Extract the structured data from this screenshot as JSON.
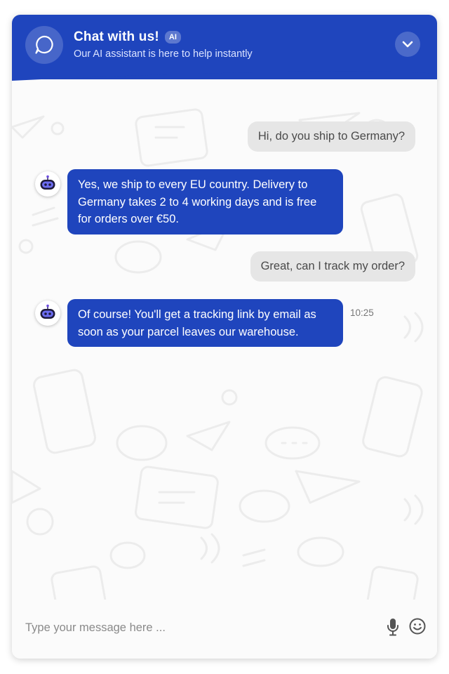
{
  "header": {
    "title": "Chat with us!",
    "badge": "AI",
    "subtitle": "Our AI assistant is here to help instantly",
    "avatar_icon": "chat-bubble-icon",
    "collapse_icon": "chevron-down-icon"
  },
  "messages": [
    {
      "sender": "user",
      "text": "Hi, do you ship to Germany?"
    },
    {
      "sender": "bot",
      "text": "Yes, we ship to every EU country. Delivery to Germany takes 2 to 4 working days and is free for orders over €50."
    },
    {
      "sender": "user",
      "text": "Great, can I track my order?"
    },
    {
      "sender": "bot",
      "text": "Of course! You'll get a tracking link by email as soon as your parcel leaves our warehouse.",
      "time": "10:25"
    }
  ],
  "composer": {
    "placeholder": "Type your message here ...",
    "mic_icon": "microphone-icon",
    "emoji_icon": "emoji-smile-icon"
  },
  "colors": {
    "brand": "#1f45bd",
    "user_bubble": "#e6e6e6",
    "background": "#fbfbfb"
  }
}
